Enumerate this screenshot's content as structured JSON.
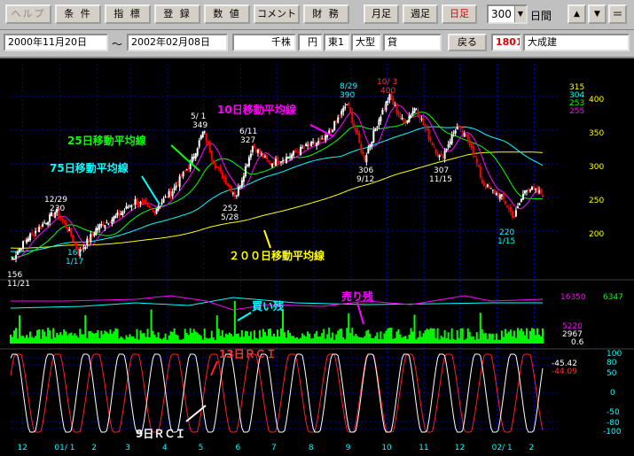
{
  "toolbar": {
    "buttons": [
      {
        "label": "ヘルプ",
        "state": "disabled"
      },
      {
        "label": "条 件"
      },
      {
        "label": "指 標"
      },
      {
        "label": "登 録"
      },
      {
        "label": "数 値"
      },
      {
        "label": "コメント"
      },
      {
        "label": "財 務"
      },
      {
        "label": "月足"
      },
      {
        "label": "週足"
      },
      {
        "label": "日足",
        "state": "active"
      }
    ],
    "period_value": "300",
    "period_unit": "日間"
  },
  "info": {
    "date_from": "2000年11月20日",
    "range_sep": "～",
    "date_to": "2002年02月08日",
    "unit": "千株",
    "currency": "円",
    "market": "東1",
    "size": "大型",
    "credit": "貸",
    "back_label": "戻る",
    "code": "1801",
    "name": "大成建"
  },
  "colors": {
    "bg": "#000000",
    "grid": "#0000c8",
    "up": "#ffffff",
    "down": "#ff0000",
    "ma10": "#ff00ff",
    "ma25": "#00ff00",
    "ma75": "#00ffff",
    "ma200": "#ffff00",
    "volume": "#00ff00",
    "rci13": "#ff2020",
    "rci9": "#ffffff"
  },
  "chart_data": [
    {
      "type": "line",
      "title": "",
      "price_axis": {
        "ticks": [
          400,
          350,
          300,
          250,
          200
        ],
        "range": [
          150,
          420
        ]
      },
      "x_ticks": [
        "12",
        "01/ 1",
        "2",
        "3",
        "4",
        "5",
        "6",
        "7",
        "8",
        "9",
        "10",
        "11",
        "12",
        "02/ 1",
        "2"
      ],
      "right_values": [
        "315",
        "304",
        "253",
        "255"
      ],
      "annotations": [
        {
          "text": "156",
          "sub": "11/21"
        },
        {
          "text": "12/29",
          "sub": "230"
        },
        {
          "text": "167",
          "sub": "1/17"
        },
        {
          "text": "5/ 1",
          "sub": "349"
        },
        {
          "text": "252",
          "sub": "5/28"
        },
        {
          "text": "6/11",
          "sub": "327"
        },
        {
          "text": "8/29",
          "sub": "390"
        },
        {
          "text": "10/ 3",
          "sub": "400"
        },
        {
          "text": "306",
          "sub": "9/12"
        },
        {
          "text": "307",
          "sub": "11/15"
        },
        {
          "text": "220",
          "sub": "1/15"
        }
      ],
      "series_labels": {
        "ma10": "10日移動平均線",
        "ma25": "25日移動平均線",
        "ma75": "75日移動平均線",
        "ma200": "２００日移動平均線"
      },
      "price_path": [
        [
          "2000-11-21",
          156
        ],
        [
          "2000-12-05",
          190
        ],
        [
          "2000-12-15",
          205
        ],
        [
          "2000-12-29",
          230
        ],
        [
          "2001-01-10",
          195
        ],
        [
          "2001-01-17",
          167
        ],
        [
          "2001-02-01",
          205
        ],
        [
          "2001-02-20",
          225
        ],
        [
          "2001-03-05",
          245
        ],
        [
          "2001-03-20",
          230
        ],
        [
          "2001-04-05",
          260
        ],
        [
          "2001-04-20",
          300
        ],
        [
          "2001-05-01",
          349
        ],
        [
          "2001-05-10",
          300
        ],
        [
          "2001-05-28",
          252
        ],
        [
          "2001-06-11",
          327
        ],
        [
          "2001-06-25",
          300
        ],
        [
          "2001-07-10",
          310
        ],
        [
          "2001-07-25",
          325
        ],
        [
          "2001-08-10",
          335
        ],
        [
          "2001-08-29",
          390
        ],
        [
          "2001-09-12",
          306
        ],
        [
          "2001-09-25",
          370
        ],
        [
          "2001-10-03",
          400
        ],
        [
          "2001-10-15",
          360
        ],
        [
          "2001-10-25",
          385
        ],
        [
          "2001-11-05",
          340
        ],
        [
          "2001-11-15",
          307
        ],
        [
          "2001-11-28",
          355
        ],
        [
          "2001-12-10",
          330
        ],
        [
          "2001-12-20",
          270
        ],
        [
          "2002-01-05",
          250
        ],
        [
          "2002-01-15",
          220
        ],
        [
          "2002-01-25",
          265
        ],
        [
          "2002-02-08",
          255
        ]
      ]
    },
    {
      "type": "bar",
      "title": "",
      "labels": {
        "buy": "買い残",
        "sell": "売り残"
      },
      "right_values": [
        "16350",
        "6347",
        "5220",
        "2967",
        "0.6"
      ]
    },
    {
      "type": "line",
      "title": "",
      "axis_ticks": [
        "100",
        "80",
        "50",
        "0",
        "-50",
        "-80",
        "-100"
      ],
      "labels": {
        "rci13": "13日ＲＣＩ",
        "rci9": "9日ＲＣＩ"
      },
      "right_values": [
        "-45.42",
        "-44.09"
      ]
    }
  ]
}
